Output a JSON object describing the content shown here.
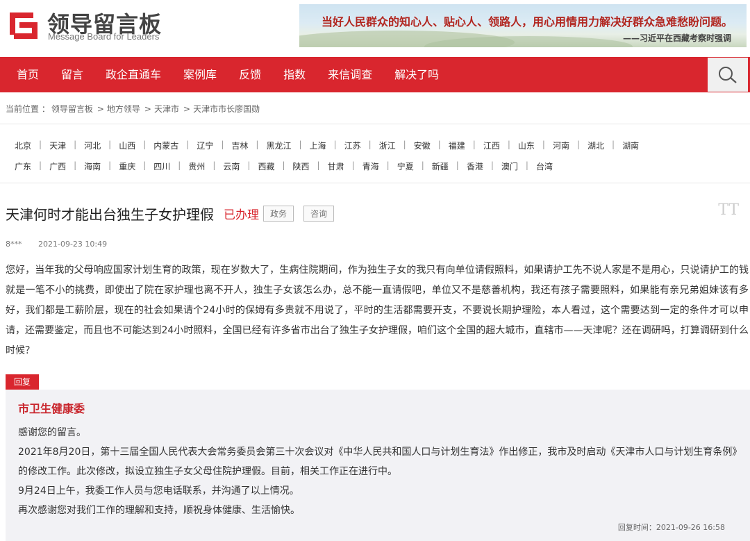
{
  "header": {
    "logo_title": "领导留言板",
    "logo_subtitle": "Message Board for Leaders",
    "banner_quote": "当好人民群众的知心人、贴心人、领路人，用心用情用力解决好群众急难愁盼问题。",
    "banner_author": "——习近平在西藏考察时强调"
  },
  "nav": {
    "items": [
      "首页",
      "留言",
      "政企直通车",
      "案例库",
      "反馈",
      "指数",
      "来信调查",
      "解决了吗"
    ],
    "search_icon": "search-icon"
  },
  "breadcrumb": {
    "prefix": "当前位置 ：",
    "items": [
      "领导留言板",
      "地方领导",
      "天津市",
      "天津市市长廖国勋"
    ],
    "separator": ">"
  },
  "regions": {
    "row1": [
      "北京",
      "天津",
      "河北",
      "山西",
      "内蒙古",
      "辽宁",
      "吉林",
      "黑龙江",
      "上海",
      "江苏",
      "浙江",
      "安徽",
      "福建",
      "江西",
      "山东",
      "河南",
      "湖北",
      "湖南"
    ],
    "row2": [
      "广东",
      "广西",
      "海南",
      "重庆",
      "四川",
      "贵州",
      "云南",
      "西藏",
      "陕西",
      "甘肃",
      "青海",
      "宁夏",
      "新疆",
      "香港",
      "澳门",
      "台湾"
    ],
    "separator": "|"
  },
  "message": {
    "title": "天津何时才能出台独生子女护理假",
    "status": "已办理",
    "tags": [
      "政务",
      "咨询"
    ],
    "font_toggle": "TT",
    "author": "8***",
    "date": "2021-09-23 10:49",
    "body": "您好，当年我的父母响应国家计划生育的政策，现在岁数大了，生病住院期间，作为独生子女的我只有向单位请假照料，如果请护工先不说人家是不是用心，只说请护工的钱就是一笔不小的挑费，即使出了院在家护理也离不开人，独生子女该怎么办，总不能一直请假吧，单位又不是慈善机构，我还有孩子需要照料，如果能有亲兄弟姐妹该有多好，我们都是工薪阶层，现在的社会如果请个24小时的保姆有多贵就不用说了，平时的生活都需要开支，不要说长期护理险，本人看过，这个需要达到一定的条件才可以申请，还需要鉴定，而且也不可能达到24小时照料，全国已经有许多省市出台了独生子女护理假，咱们这个全国的超大城市，直辖市——天津呢？还在调研吗，打算调研到什么时候？"
  },
  "reply": {
    "label": "回复",
    "org": "市卫生健康委",
    "paragraphs": [
      "感谢您的留言。",
      "2021年8月20日，第十三届全国人民代表大会常务委员会第三十次会议对《中华人民共和国人口与计划生育法》作出修正，我市及时启动《天津市人口与计划生育条例》的修改工作。此次修改，拟设立独生子女父母住院护理假。目前，相关工作正在进行中。",
      "9月24日上午，我委工作人员与您电话联系，并沟通了以上情况。",
      "再次感谢您对我们工作的理解和支持，顺祝身体健康、生活愉快。"
    ],
    "time_label": "回复时间：",
    "time": "2021-09-26 16:58"
  },
  "colors": {
    "brand_red": "#d9262e",
    "reply_bg": "#f2f2f5"
  }
}
